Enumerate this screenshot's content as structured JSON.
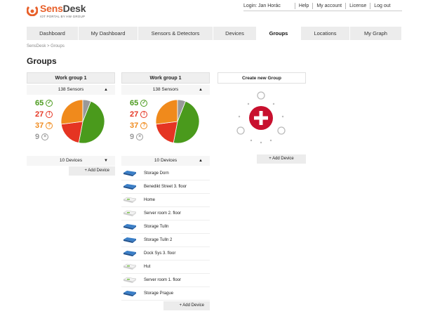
{
  "app": {
    "logo_text_a": "Sens",
    "logo_text_b": "Desk",
    "logo_subtitle": "IOT PORTAL BY HW GROUP"
  },
  "topbar": {
    "login": "Login: Jan Horác",
    "help": "Help",
    "account": "My account",
    "license": "License",
    "logout": "Log out"
  },
  "nav": {
    "tabs": [
      {
        "label": "Dashboard"
      },
      {
        "label": "My Dashboard"
      },
      {
        "label": "Sensors & Detectors"
      },
      {
        "label": "Devices"
      },
      {
        "label": "Groups"
      },
      {
        "label": "Locations"
      },
      {
        "label": "My Graph"
      }
    ],
    "active": "Groups"
  },
  "breadcrumb": "SensDesk > Groups",
  "page_title": "Groups",
  "groups": [
    {
      "name": "Work group 1",
      "sensors_label": "138 Sensors",
      "stats": {
        "ok": "65",
        "alarm": "27",
        "warning": "37",
        "offline": "9"
      },
      "devices_label": "10 Devices",
      "add_device": "+ Add Device",
      "pie": {
        "ok": 0.47,
        "alarm": 0.2,
        "warning": 0.27,
        "offline": 0.06
      }
    },
    {
      "name": "Work group 1",
      "sensors_label": "138 Sensors",
      "stats": {
        "ok": "65",
        "alarm": "27",
        "warning": "37",
        "offline": "9"
      },
      "devices_label": "10 Devices",
      "add_device": "+ Add Device",
      "pie": {
        "ok": 0.47,
        "alarm": 0.2,
        "warning": 0.27,
        "offline": 0.06
      },
      "devices": [
        {
          "name": "Storage Dorn",
          "type": "blue"
        },
        {
          "name": "Benedikt Street 3. floor",
          "type": "blue"
        },
        {
          "name": "Home",
          "type": "white"
        },
        {
          "name": "Server room 2. floor",
          "type": "white"
        },
        {
          "name": "Storage Tulln",
          "type": "blue"
        },
        {
          "name": "Storage Tulln 2",
          "type": "blue"
        },
        {
          "name": "Dock Sys 3. floor",
          "type": "blue"
        },
        {
          "name": "Hut",
          "type": "white"
        },
        {
          "name": "Server room 1. floor",
          "type": "white"
        },
        {
          "name": "Storage Prague",
          "type": "blue"
        }
      ]
    }
  ],
  "create_group": {
    "label": "Create new Group",
    "add_device": "+ Add Device"
  },
  "colors": {
    "brand": "#e8602a",
    "ok": "#4a9a1c",
    "alarm": "#e53422",
    "warning": "#f08a1c",
    "offline": "#999999",
    "create_red": "#c8102e"
  }
}
